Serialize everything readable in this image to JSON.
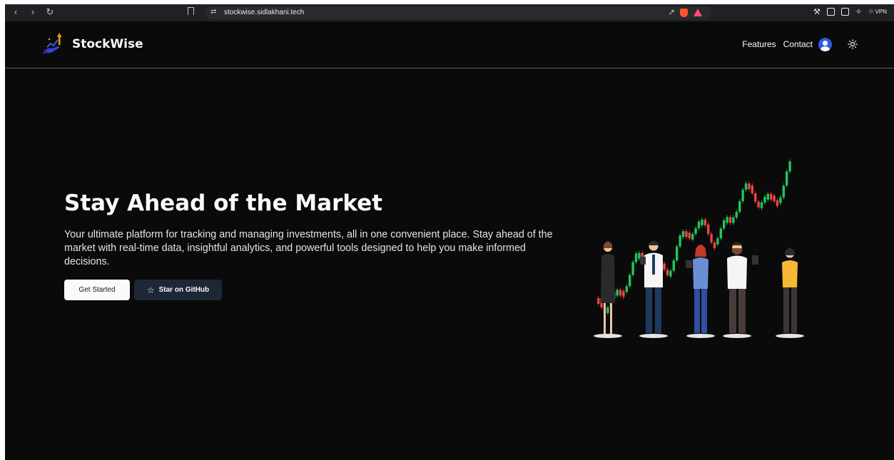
{
  "browser": {
    "url": "stockwise.sidlakhani.tech",
    "vpn_label": "VPN"
  },
  "header": {
    "brand": "StockWise",
    "nav": [
      {
        "label": "Features"
      },
      {
        "label": "Contact"
      }
    ]
  },
  "hero": {
    "title": "Stay Ahead of the Market",
    "description": "Your ultimate platform for tracking and managing investments, all in one convenient place. Stay ahead of the market with real-time data, insightful analytics, and powerful tools designed to help you make informed decisions.",
    "primary_button": "Get Started",
    "secondary_button": "Star on GitHub"
  },
  "colors": {
    "page_bg": "#0a0a0a",
    "candle_up": "#22c55e",
    "candle_down": "#ef4444",
    "avatar": "#2b5ce6",
    "secondary_button_bg": "#1e2736"
  },
  "icons": {
    "logo": "growth-chart-hand-icon",
    "avatar": "user-icon",
    "theme": "sun-icon",
    "github_star": "star-icon"
  }
}
